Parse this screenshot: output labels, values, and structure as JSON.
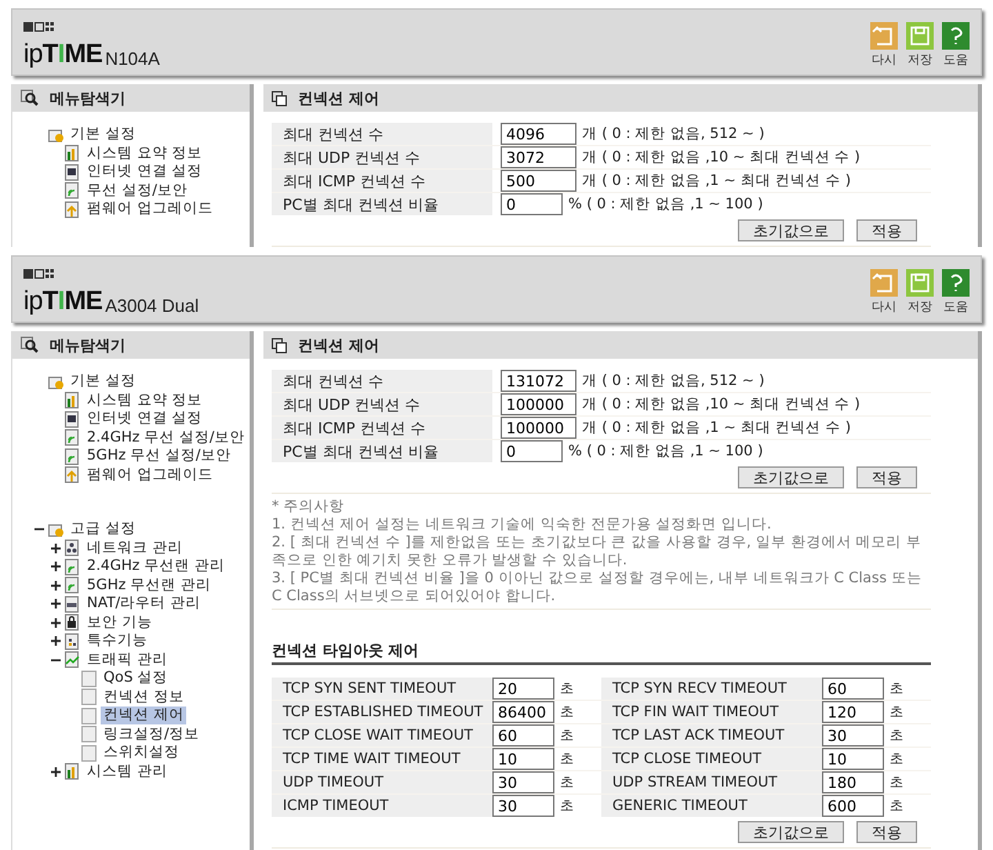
{
  "screens": [
    {
      "brand": {
        "logo": [
          "ip",
          "T",
          "I",
          "ME"
        ],
        "model": "N104A"
      },
      "toolbar": [
        {
          "kind": "reset",
          "label": "다시"
        },
        {
          "kind": "save",
          "label": "저장"
        },
        {
          "kind": "help",
          "label": "도움"
        }
      ],
      "sidebar": {
        "title": "메뉴탐색기",
        "tree": [
          {
            "label": "기본 설정",
            "kind": "folder",
            "selected": false,
            "children": [
              {
                "label": "시스템 요약 정보",
                "kind": "chart",
                "selected": false
              },
              {
                "label": "인터넷 연결 설정",
                "kind": "monitor",
                "selected": false
              },
              {
                "label": "무선 설정/보안",
                "kind": "wireless",
                "selected": false
              },
              {
                "label": "펌웨어 업그레이드",
                "kind": "upgrade",
                "selected": false
              }
            ]
          }
        ]
      },
      "panel": {
        "title": "컨넥션 제어",
        "fields": [
          {
            "label": "최대 컨넥션 수",
            "value": "4096",
            "hint": "개 ( 0 : 제한 없음, 512 ~ )"
          },
          {
            "label": "최대 UDP 컨넥션 수",
            "value": "3072",
            "hint": "개 ( 0 : 제한 없음 ,10 ~ 최대 컨넥션 수 )"
          },
          {
            "label": "최대 ICMP 컨넥션 수",
            "value": "500",
            "hint": "개 ( 0 : 제한 없음 ,1 ~ 최대 컨넥션 수 )"
          },
          {
            "label": "PC별 최대 컨넥션 비율",
            "value": "0",
            "hint": "% ( 0 : 제한 없음 ,1 ~ 100 )"
          }
        ],
        "buttons": [
          "초기값으로",
          "적용"
        ]
      }
    },
    {
      "brand": {
        "logo": [
          "ip",
          "T",
          "I",
          "ME"
        ],
        "model": "A3004 Dual"
      },
      "toolbar": [
        {
          "kind": "reset",
          "label": "다시"
        },
        {
          "kind": "save",
          "label": "저장"
        },
        {
          "kind": "help",
          "label": "도움"
        }
      ],
      "sidebar": {
        "title": "메뉴탐색기",
        "tree": [
          {
            "label": "기본 설정",
            "kind": "folder",
            "selected": false,
            "children": [
              {
                "label": "시스템 요약 정보",
                "kind": "chart",
                "selected": false
              },
              {
                "label": "인터넷 연결 설정",
                "kind": "monitor",
                "selected": false
              },
              {
                "label": "2.4GHz 무선 설정/보안",
                "kind": "wireless",
                "selected": false
              },
              {
                "label": "5GHz 무선 설정/보안",
                "kind": "wireless",
                "selected": false
              },
              {
                "label": "펌웨어 업그레이드",
                "kind": "upgrade",
                "selected": false
              }
            ]
          },
          {
            "label": "고급 설정",
            "kind": "folder",
            "selected": false,
            "expanded": true,
            "children": [
              {
                "label": "네트워크 관리",
                "kind": "network",
                "selected": false,
                "expanded": false
              },
              {
                "label": "2.4GHz 무선랜 관리",
                "kind": "wireless",
                "selected": false,
                "expanded": false
              },
              {
                "label": "5GHz 무선랜 관리",
                "kind": "wireless",
                "selected": false,
                "expanded": false
              },
              {
                "label": "NAT/라우터 관리",
                "kind": "router",
                "selected": false,
                "expanded": false
              },
              {
                "label": "보안 기능",
                "kind": "lock",
                "selected": false,
                "expanded": false
              },
              {
                "label": "특수기능",
                "kind": "tools",
                "selected": false,
                "expanded": false
              },
              {
                "label": "트래픽 관리",
                "kind": "traffic",
                "selected": false,
                "expanded": true,
                "children": [
                  {
                    "label": "QoS 설정",
                    "kind": "page",
                    "selected": false
                  },
                  {
                    "label": "컨넥션 정보",
                    "kind": "page",
                    "selected": false
                  },
                  {
                    "label": "컨넥션 제어",
                    "kind": "page",
                    "selected": true
                  },
                  {
                    "label": "링크설정/정보",
                    "kind": "page",
                    "selected": false
                  },
                  {
                    "label": "스위치설정",
                    "kind": "page",
                    "selected": false
                  }
                ]
              },
              {
                "label": "시스템 관리",
                "kind": "chart",
                "selected": false,
                "expanded": false
              }
            ]
          }
        ]
      },
      "panel": {
        "title": "컨넥션 제어",
        "fields": [
          {
            "label": "최대 컨넥션 수",
            "value": "131072",
            "hint": "개 ( 0 : 제한 없음, 512 ~ )"
          },
          {
            "label": "최대 UDP 컨넥션 수",
            "value": "100000",
            "hint": "개 ( 0 : 제한 없음 ,10 ~ 최대 컨넥션 수 )"
          },
          {
            "label": "최대 ICMP 컨넥션 수",
            "value": "100000",
            "hint": "개 ( 0 : 제한 없음 ,1 ~ 최대 컨넥션 수 )"
          },
          {
            "label": "PC별 최대 컨넥션 비율",
            "value": "0",
            "hint": "% ( 0 : 제한 없음 ,1 ~ 100 )"
          }
        ],
        "buttons": [
          "초기값으로",
          "적용"
        ],
        "notes": [
          "* 주의사항",
          "1. 컨넥션 제어 설정는 네트워크 기술에 익숙한 전문가용 설정화면 입니다.",
          "2. [ 최대 컨넥션 수 ]를 제한없음 또는 초기값보다 큰 값을 사용할 경우, 일부 환경에서 메모리 부족으로 인한 예기치 못한 오류가 발생할 수 있습니다.",
          "3. [ PC별 최대 컨넥션 비율 ]을 0 이아닌 값으로 설정할 경우에는, 내부 네트워크가 C Class 또는 C Class의 서브넷으로 되어있어야 합니다."
        ],
        "timeouts": {
          "title": "컨넥션 타임아웃 제어",
          "items": [
            {
              "label": "TCP SYN SENT TIMEOUT",
              "value": "20",
              "unit": "초"
            },
            {
              "label": "TCP SYN RECV TIMEOUT",
              "value": "60",
              "unit": "초"
            },
            {
              "label": "TCP ESTABLISHED TIMEOUT",
              "value": "86400",
              "unit": "초"
            },
            {
              "label": "TCP FIN WAIT TIMEOUT",
              "value": "120",
              "unit": "초"
            },
            {
              "label": "TCP CLOSE WAIT TIMEOUT",
              "value": "60",
              "unit": "초"
            },
            {
              "label": "TCP LAST ACK TIMEOUT",
              "value": "30",
              "unit": "초"
            },
            {
              "label": "TCP TIME WAIT TIMEOUT",
              "value": "10",
              "unit": "초"
            },
            {
              "label": "TCP CLOSE TIMEOUT",
              "value": "10",
              "unit": "초"
            },
            {
              "label": "UDP TIMEOUT",
              "value": "30",
              "unit": "초"
            },
            {
              "label": "UDP STREAM TIMEOUT",
              "value": "180",
              "unit": "초"
            },
            {
              "label": "ICMP TIMEOUT",
              "value": "30",
              "unit": "초"
            },
            {
              "label": "GENERIC TIMEOUT",
              "value": "600",
              "unit": "초"
            }
          ],
          "buttons": [
            "초기값으로",
            "적용"
          ]
        }
      }
    }
  ]
}
